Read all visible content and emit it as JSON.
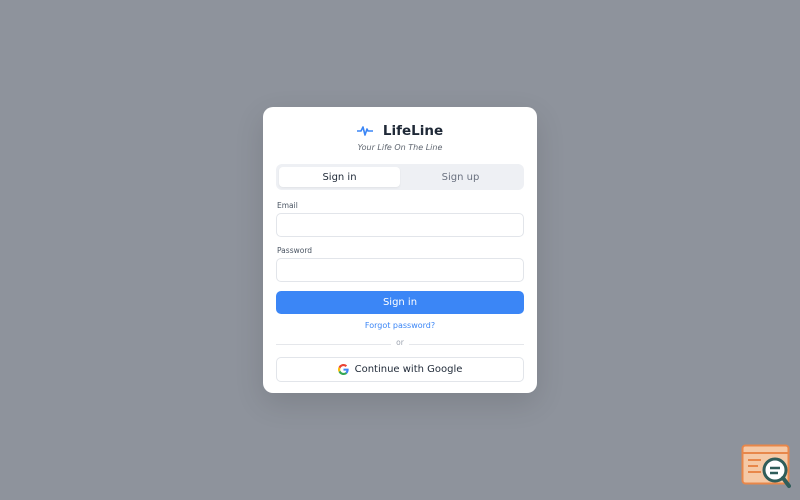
{
  "brand": {
    "name": "LifeLine",
    "tagline": "Your Life On The Line",
    "accent_color": "#3b86f6",
    "icon": "pulse-icon"
  },
  "tabs": [
    {
      "label": "Sign in",
      "active": true
    },
    {
      "label": "Sign up",
      "active": false
    }
  ],
  "form": {
    "email_label": "Email",
    "email_value": "",
    "password_label": "Password",
    "password_value": "",
    "submit_label": "Sign in",
    "forgot_label": "Forgot password?",
    "divider_label": "or",
    "google_label": "Continue with Google",
    "google_icon": "google-icon"
  },
  "corner_badge": {
    "icon": "search-document-icon"
  }
}
